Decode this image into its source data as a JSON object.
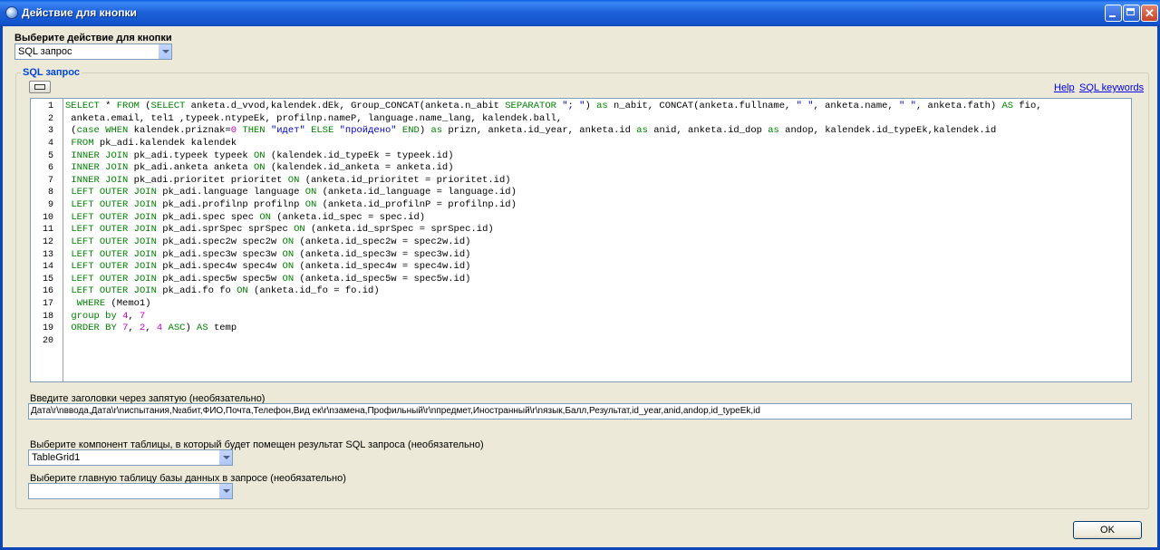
{
  "window": {
    "title": "Действие для кнопки"
  },
  "action": {
    "label": "Выберите действие для кнопки",
    "selected": "SQL запрос"
  },
  "sql": {
    "group_title": "SQL запрос",
    "help_link": "Help",
    "keywords_link": "SQL keywords",
    "line_numbers": [
      "1",
      "2",
      "3",
      "4",
      "5",
      "6",
      "7",
      "8",
      "9",
      "10",
      "11",
      "12",
      "13",
      "14",
      "15",
      "16",
      "17",
      "18",
      "19",
      "20"
    ],
    "lines": [
      "SELECT * FROM (SELECT anketa.d_vvod,kalendek.dEk, Group_CONCAT(anketa.n_abit SEPARATOR \"; \") as n_abit, CONCAT(anketa.fullname, \" \", anketa.name, \" \", anketa.fath) AS fio,",
      " anketa.email, tel1 ,typeek.ntypeEk, profilnp.nameP, language.name_lang, kalendek.ball,",
      " (case WHEN kalendek.priznak=0 THEN \"идет\" ELSE \"пройдено\" END) as prizn, anketa.id_year, anketa.id as anid, anketa.id_dop as andop, kalendek.id_typeEk,kalendek.id",
      " FROM pk_adi.kalendek kalendek",
      " INNER JOIN pk_adi.typeek typeek ON (kalendek.id_typeEk = typeek.id)",
      " INNER JOIN pk_adi.anketa anketa ON (kalendek.id_anketa = anketa.id)",
      " INNER JOIN pk_adi.prioritet prioritet ON (anketa.id_prioritet = prioritet.id)",
      " LEFT OUTER JOIN pk_adi.language language ON (anketa.id_language = language.id)",
      " LEFT OUTER JOIN pk_adi.profilnp profilnp ON (anketa.id_profilnP = profilnp.id)",
      " LEFT OUTER JOIN pk_adi.spec spec ON (anketa.id_spec = spec.id)",
      " LEFT OUTER JOIN pk_adi.sprSpec sprSpec ON (anketa.id_sprSpec = sprSpec.id)",
      " LEFT OUTER JOIN pk_adi.spec2w spec2w ON (anketa.id_spec2w = spec2w.id)",
      " LEFT OUTER JOIN pk_adi.spec3w spec3w ON (anketa.id_spec3w = spec3w.id)",
      " LEFT OUTER JOIN pk_adi.spec4w spec4w ON (anketa.id_spec4w = spec4w.id)",
      " LEFT OUTER JOIN pk_adi.spec5w spec5w ON (anketa.id_spec5w = spec5w.id)",
      " LEFT OUTER JOIN pk_adi.fo fo ON (anketa.id_fo = fo.id)",
      "  WHERE (Memo1)",
      " group by 4, 7",
      " ORDER BY 7, 2, 4 ASC) AS temp",
      ""
    ],
    "keywords": [
      "SELECT",
      "FROM",
      "AS",
      "as",
      "case",
      "WHEN",
      "THEN",
      "ELSE",
      "END",
      "INNER",
      "JOIN",
      "ON",
      "LEFT",
      "OUTER",
      "WHERE",
      "group",
      "by",
      "ORDER",
      "BY",
      "ASC",
      "SEPARATOR"
    ]
  },
  "headers": {
    "label": "Введите заголовки через запятую (необязательно)",
    "value": "Дата\\r\\nввода,Дата\\r\\nиспытания,№абит,ФИО,Почта,Телефон,Вид ек\\r\\nзамена,Профильный\\r\\nпредмет,Иностранный\\r\\nязык,Балл,Результат,id_year,anid,andop,id_typeEk,id"
  },
  "table_component": {
    "label": "Выберите компонент таблицы, в который будет помещен результат SQL запроса (необязательно)",
    "selected": "TableGrid1"
  },
  "main_table": {
    "label": "Выберите главную таблицу базы данных в запросе (необязательно)",
    "selected": ""
  },
  "ok_button": "OK"
}
